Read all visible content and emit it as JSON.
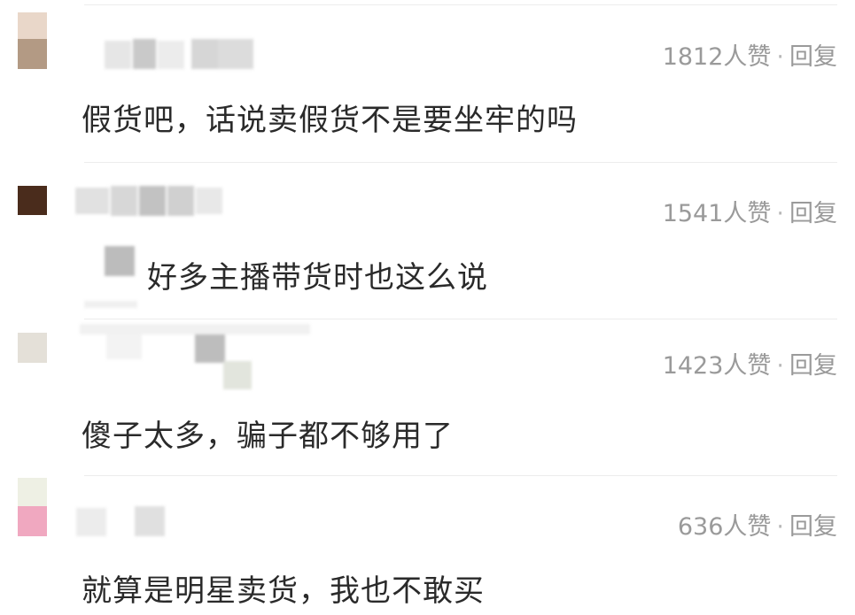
{
  "comments": [
    {
      "likes": "1812",
      "like_suffix": "人赞",
      "separator": "·",
      "reply": "回复",
      "text": "假货吧，话说卖假货不是要坐牢的吗"
    },
    {
      "likes": "1541",
      "like_suffix": "人赞",
      "separator": "·",
      "reply": "回复",
      "text": "好多主播带货时也这么说"
    },
    {
      "likes": "1423",
      "like_suffix": "人赞",
      "separator": "·",
      "reply": "回复",
      "text": "傻子太多，骗子都不够用了"
    },
    {
      "likes": "636",
      "like_suffix": "人赞",
      "separator": "·",
      "reply": "回复",
      "text": "就算是明星卖货，我也不敢买"
    }
  ]
}
